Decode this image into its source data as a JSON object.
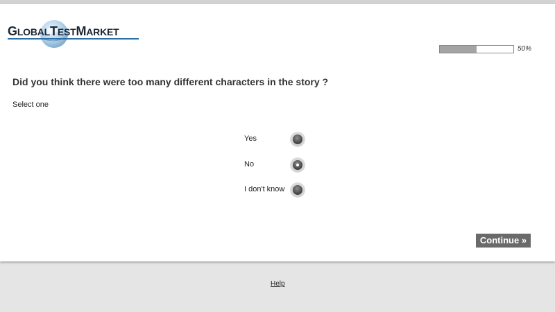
{
  "brand": {
    "logo_text": "GlobalTestMarket",
    "accent_color": "#2b6fa6"
  },
  "progress": {
    "value_percent": 50,
    "label": "50%"
  },
  "question": {
    "text": "Did you think there were too many different characters in the story ?",
    "instruction": "Select one",
    "options": [
      {
        "label": "Yes",
        "selected": false
      },
      {
        "label": "No",
        "selected": true
      },
      {
        "label": "I don't know",
        "selected": false
      }
    ]
  },
  "actions": {
    "continue_label": "Continue »"
  },
  "footer": {
    "help_label": "Help"
  }
}
